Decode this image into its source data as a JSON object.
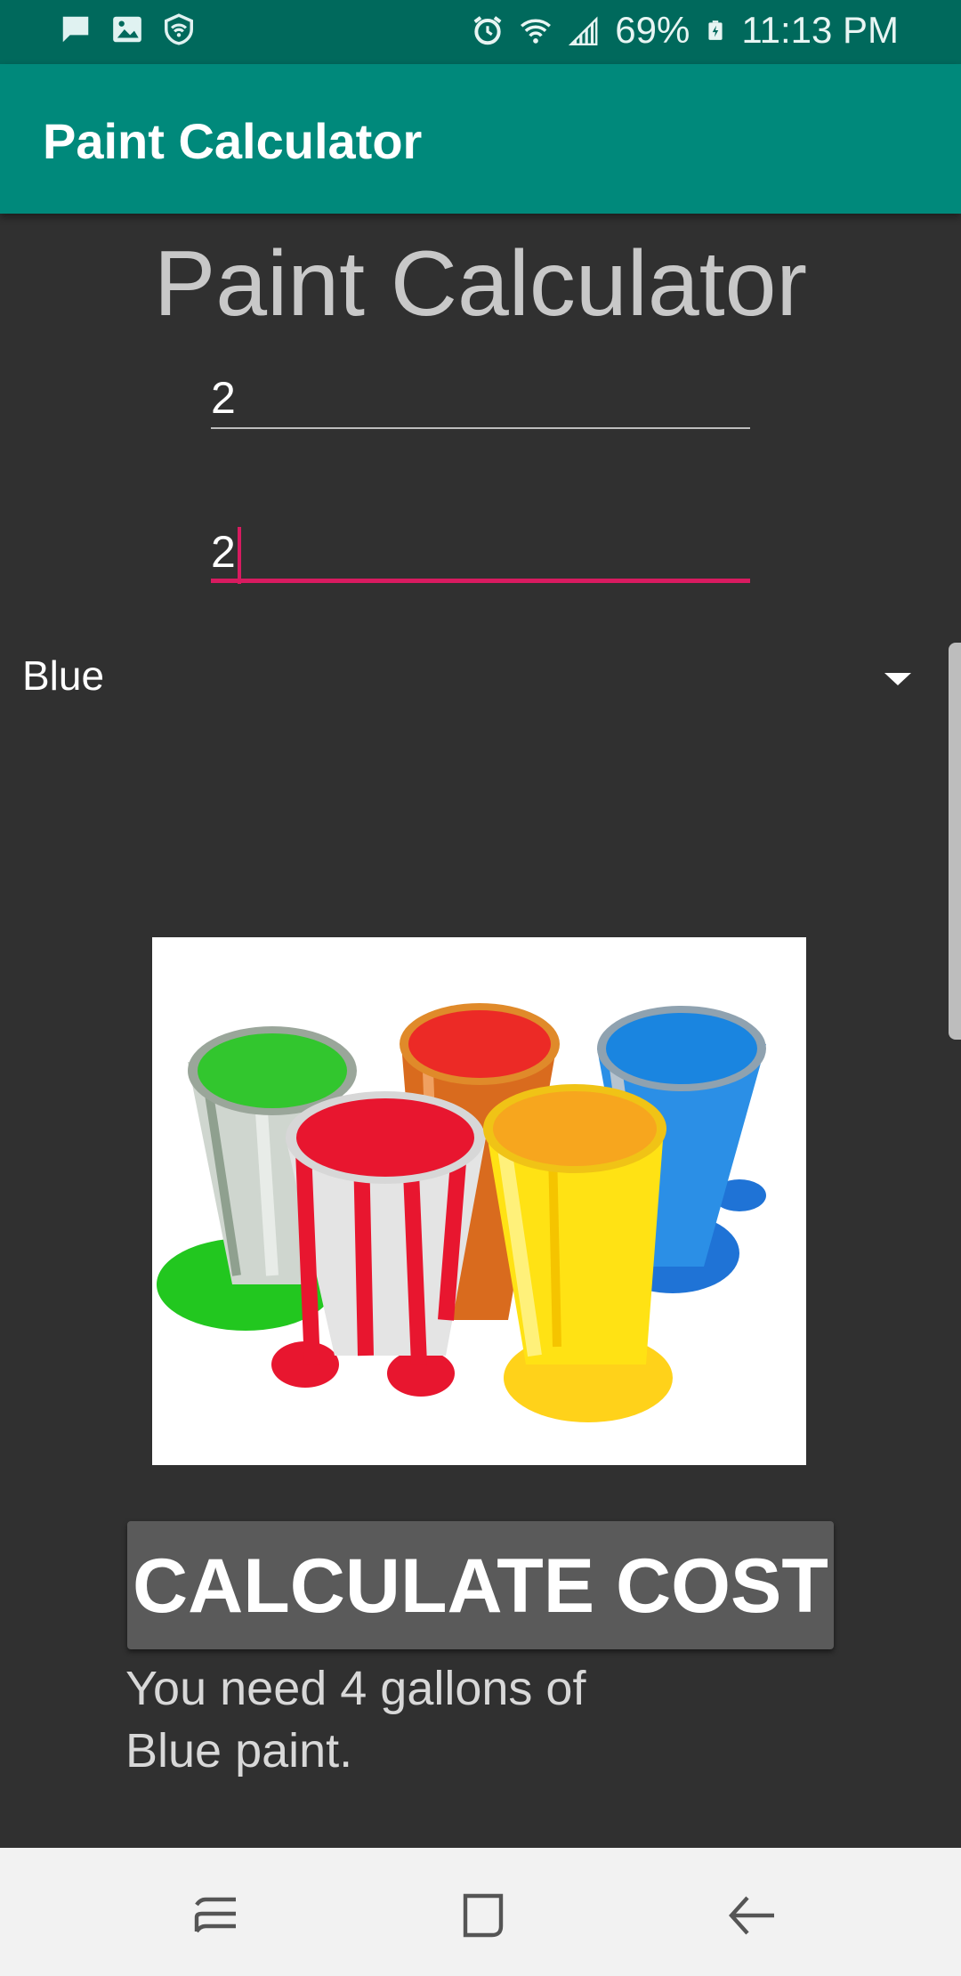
{
  "status_bar": {
    "battery": "69%",
    "time": "11:13 PM",
    "left_icons": [
      "message-icon",
      "image-icon",
      "shield-wifi-icon"
    ],
    "right_icons": [
      "alarm-icon",
      "wifi-icon",
      "signal-icon",
      "battery-icon"
    ]
  },
  "app_bar": {
    "title": "Paint Calculator"
  },
  "main": {
    "heading": "Paint Calculator",
    "field1_value": "2",
    "field2_value": "2",
    "color_spinner": {
      "selected": "Blue"
    },
    "image_alt": "paint cans",
    "button_label": "CALCULATE COST",
    "result_text": "You need 4 gallons of Blue paint."
  },
  "nav_bar": {
    "buttons": [
      "recents-icon",
      "home-icon",
      "back-icon"
    ]
  },
  "colors": {
    "status_bar": "#00695c",
    "app_bar": "#00897b",
    "background": "#303030",
    "accent": "#d81b60",
    "button": "#5a5a5a"
  }
}
